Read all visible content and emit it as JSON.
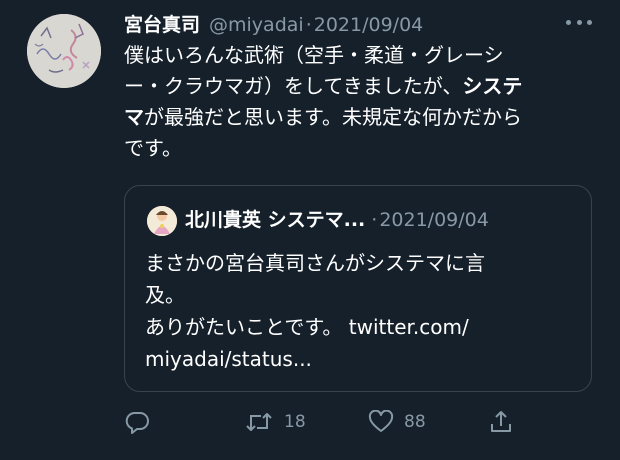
{
  "tweet": {
    "author_name": "宮台真司",
    "handle": "@miyadai",
    "separator": "·",
    "date": "2021/09/04",
    "body_lines": [
      {
        "pre": "僕はいろんな武術（空手・柔道・グレーシ",
        "bold": "",
        "post": ""
      },
      {
        "pre": "ー・クラウマガ）をしてきましたが、",
        "bold": "システ",
        "post": ""
      },
      {
        "pre": "",
        "bold": "マ",
        "post": "が最強だと思います。未規定な何かだから"
      },
      {
        "pre": "です。",
        "bold": "",
        "post": ""
      }
    ]
  },
  "quote": {
    "author_name": "北川貴英 システマ...",
    "separator": "·",
    "date": "2021/09/04",
    "lines": [
      "まさかの宮台真司さんがシステマに言",
      "及。",
      "ありがたいことです。 twitter.com/",
      "miyadai/status..."
    ]
  },
  "actions": {
    "reply_count": "",
    "retweet_count": "18",
    "like_count": "88"
  },
  "icons": {
    "reply": "reply-icon",
    "retweet": "retweet-icon",
    "like": "heart-icon",
    "share": "share-icon",
    "more": "more-icon"
  },
  "colors": {
    "background": "#15202b",
    "secondary_text": "#8899a6",
    "border": "#38444d"
  }
}
